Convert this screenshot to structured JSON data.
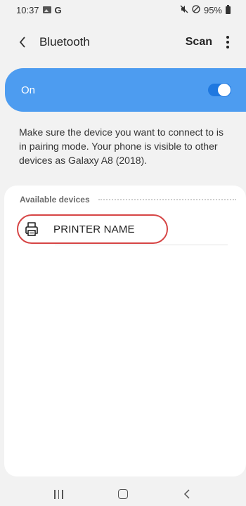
{
  "status_bar": {
    "time": "10:37",
    "left_icons": [
      "gallery-icon",
      "g-icon"
    ],
    "g_letter": "G",
    "battery": "95%",
    "right_icons": [
      "mute-icon",
      "no-disturb-icon",
      "battery-icon"
    ]
  },
  "app_bar": {
    "title": "Bluetooth",
    "scan_label": "Scan"
  },
  "toggle": {
    "label": "On",
    "state": true,
    "accent_color": "#4d9cf0"
  },
  "description": "Make sure the device you want to connect to is in pairing mode. Your phone is visible to other devices as Galaxy A8 (2018).",
  "available_devices": {
    "header": "Available devices",
    "items": [
      {
        "name": "PRINTER NAME",
        "icon": "printer-icon",
        "highlighted": true
      }
    ]
  },
  "nav_bar": {
    "buttons": [
      "recent-apps",
      "home",
      "back"
    ]
  }
}
